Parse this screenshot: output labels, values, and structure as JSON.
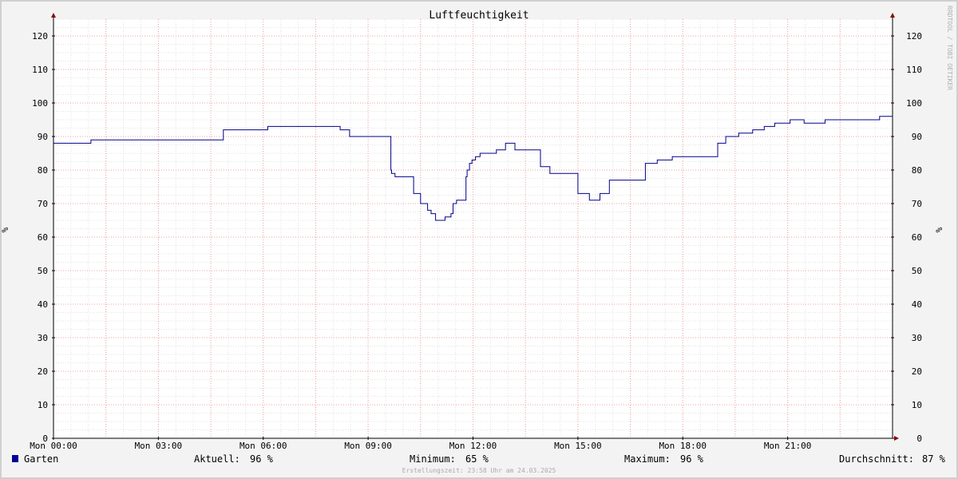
{
  "chart_data": {
    "type": "line",
    "title": "Luftfeuchtigkeit",
    "ylabel": "%",
    "ylim": [
      0,
      125
    ],
    "yticks": [
      0,
      10,
      20,
      30,
      40,
      50,
      60,
      70,
      80,
      90,
      100,
      110,
      120
    ],
    "xlim": [
      0,
      24
    ],
    "xticks": [
      {
        "value": 0,
        "label": "Mon 00:00"
      },
      {
        "value": 3,
        "label": "Mon 03:00"
      },
      {
        "value": 6,
        "label": "Mon 06:00"
      },
      {
        "value": 9,
        "label": "Mon 09:00"
      },
      {
        "value": 12,
        "label": "Mon 12:00"
      },
      {
        "value": 15,
        "label": "Mon 15:00"
      },
      {
        "value": 18,
        "label": "Mon 18:00"
      },
      {
        "value": 21,
        "label": "Mon 21:00"
      }
    ],
    "grid": true,
    "legend_position": "bottom-left",
    "series": [
      {
        "name": "Garten",
        "color": "#00008b",
        "legend_color": "#000099",
        "x": [
          0.0,
          1.07,
          4.86,
          6.13,
          8.2,
          8.47,
          9.65,
          9.67,
          9.77,
          10.3,
          10.5,
          10.7,
          10.8,
          10.93,
          10.97,
          11.2,
          11.37,
          11.43,
          11.53,
          11.8,
          11.83,
          11.9,
          11.97,
          12.07,
          12.2,
          12.67,
          12.93,
          13.2,
          13.93,
          14.2,
          15.0,
          15.33,
          15.63,
          15.9,
          15.97,
          16.93,
          17.27,
          17.7,
          19.0,
          19.23,
          19.6,
          20.0,
          20.33,
          20.63,
          21.07,
          21.47,
          22.07,
          23.63,
          24.0
        ],
        "y": [
          88,
          89,
          92,
          93,
          92,
          90,
          80,
          79,
          78,
          73,
          70,
          68,
          67,
          65,
          65,
          66,
          67,
          70,
          71,
          78,
          80,
          82,
          83,
          84,
          85,
          86,
          88,
          86,
          81,
          79,
          73,
          71,
          73,
          77,
          77,
          82,
          83,
          84,
          88,
          90,
          91,
          92,
          93,
          94,
          95,
          94,
          95,
          96,
          96
        ]
      }
    ],
    "stats": {
      "current_label": "Aktuell:",
      "current_value": "96 %",
      "min_label": "Minimum:",
      "min_value": "65 %",
      "max_label": "Maximum:",
      "max_value": "96 %",
      "avg_label": "Durchschnitt:",
      "avg_value": "87 %"
    },
    "footer": "Erstellungszeit: 23:58 Uhr am 24.03.2025",
    "watermark": "RRDTOOL / TOBI OETIKER"
  }
}
